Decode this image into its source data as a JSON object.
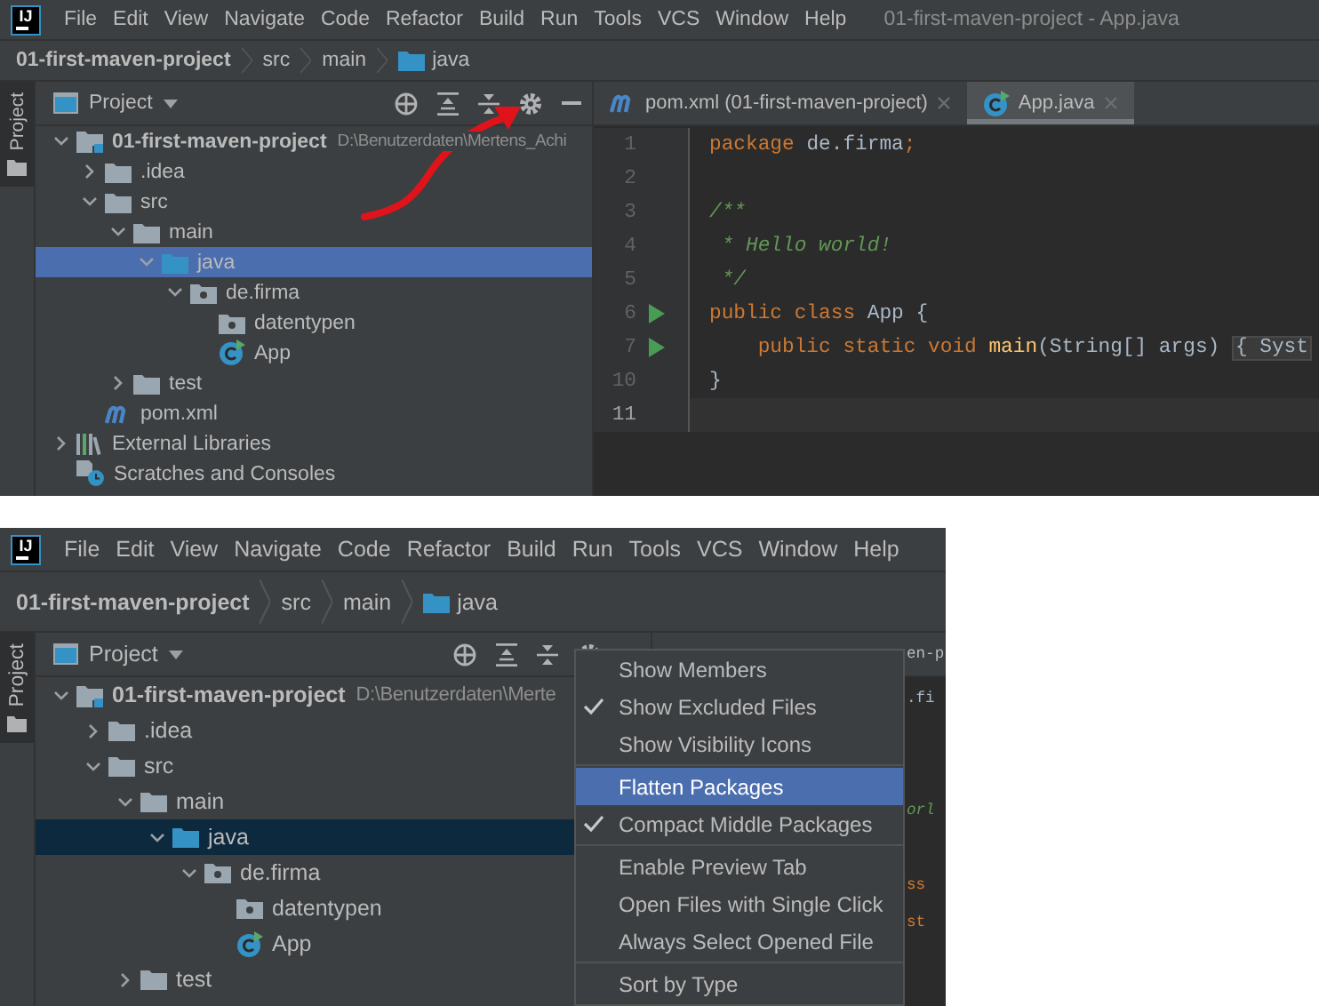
{
  "screenshots": [
    {
      "menu_bar": {
        "logo": "IJ",
        "items": [
          "File",
          "Edit",
          "View",
          "Navigate",
          "Code",
          "Refactor",
          "Build",
          "Run",
          "Tools",
          "VCS",
          "Window",
          "Help"
        ],
        "title": "01-first-maven-project - App.java"
      },
      "breadcrumb": [
        {
          "text": "01-first-maven-project",
          "kind": "project"
        },
        {
          "text": "src",
          "kind": "plain"
        },
        {
          "text": "main",
          "kind": "plain"
        },
        {
          "text": "java",
          "kind": "folder"
        }
      ],
      "tool_stripe": {
        "label": "Project",
        "selected": true
      },
      "project_panel": {
        "title": "Project",
        "focused": true,
        "tree": [
          {
            "label": "01-first-maven-project",
            "path": "D:\\Benutzerdaten\\Mertens_Achi",
            "kind": "module",
            "expanded": true,
            "selected": false,
            "children": [
              {
                "label": ".idea",
                "kind": "folder",
                "expanded": false,
                "selected": false
              },
              {
                "label": "src",
                "kind": "folder",
                "expanded": true,
                "selected": false,
                "children": [
                  {
                    "label": "main",
                    "kind": "folder",
                    "expanded": true,
                    "selected": false,
                    "children": [
                      {
                        "label": "java",
                        "kind": "source",
                        "expanded": true,
                        "selected": true,
                        "children": [
                          {
                            "label": "de.firma",
                            "kind": "package",
                            "expanded": true,
                            "selected": false,
                            "children": [
                              {
                                "label": "datentypen",
                                "kind": "package",
                                "selected": false
                              },
                              {
                                "label": "App",
                                "kind": "class",
                                "selected": false
                              }
                            ]
                          }
                        ]
                      }
                    ]
                  },
                  {
                    "label": "test",
                    "kind": "folder",
                    "expanded": false,
                    "selected": false
                  }
                ]
              },
              {
                "label": "pom.xml",
                "kind": "maven",
                "selected": false
              }
            ]
          },
          {
            "label": "External Libraries",
            "kind": "library",
            "expanded": false,
            "selected": false
          },
          {
            "label": "Scratches and Consoles",
            "kind": "scratches",
            "selected": false
          }
        ]
      },
      "editor": {
        "tabs": [
          {
            "label": "pom.xml (01-first-maven-project)",
            "kind": "maven",
            "selected": false
          },
          {
            "label": "App.java",
            "kind": "class",
            "selected": true
          }
        ],
        "lines": [
          {
            "number": "1",
            "run": false,
            "current": false,
            "tokens": [
              {
                "kind": "keyword",
                "text": "package"
              },
              {
                "kind": "plain",
                "text": " de.firma"
              },
              {
                "kind": "keyword",
                "text": ";"
              }
            ]
          },
          {
            "number": "2",
            "run": false,
            "current": false
          },
          {
            "number": "3",
            "run": false,
            "current": false,
            "tokens": [
              {
                "kind": "comment",
                "text": "/**"
              }
            ]
          },
          {
            "number": "4",
            "run": false,
            "current": false,
            "tokens": [
              {
                "kind": "comment",
                "text": " * Hello world!"
              }
            ]
          },
          {
            "number": "5",
            "run": false,
            "current": false,
            "tokens": [
              {
                "kind": "comment",
                "text": " */"
              }
            ]
          },
          {
            "number": "6",
            "run": true,
            "current": false,
            "tokens": [
              {
                "kind": "keyword",
                "text": "public class"
              },
              {
                "kind": "plain",
                "text": " App {"
              }
            ]
          },
          {
            "number": "7",
            "run": true,
            "current": false,
            "tokens": [
              {
                "kind": "keyword",
                "text": "    public static void"
              },
              {
                "kind": "method",
                "text": " main"
              },
              {
                "kind": "plain",
                "text": "(String[] args) "
              },
              {
                "kind": "folded",
                "text": "{ Syst"
              }
            ]
          },
          {
            "number": "10",
            "run": false,
            "current": false,
            "tokens": [
              {
                "kind": "plain",
                "text": "}"
              }
            ]
          },
          {
            "number": "11",
            "run": false,
            "current": true
          }
        ]
      },
      "annotation": {
        "kind": "arrow"
      }
    },
    {
      "menu_bar": {
        "logo": "IJ",
        "items": [
          "File",
          "Edit",
          "View",
          "Navigate",
          "Code",
          "Refactor",
          "Build",
          "Run",
          "Tools",
          "VCS",
          "Window",
          "Help"
        ]
      },
      "breadcrumb": [
        {
          "text": "01-first-maven-project",
          "kind": "project"
        },
        {
          "text": "src",
          "kind": "plain"
        },
        {
          "text": "main",
          "kind": "plain"
        },
        {
          "text": "java",
          "kind": "folder"
        }
      ],
      "tool_stripe": {
        "label": "Project",
        "selected": true
      },
      "project_panel": {
        "title": "Project",
        "focused": false,
        "tree": [
          {
            "label": "01-first-maven-project",
            "path": "D:\\Benutzerdaten\\Merte",
            "kind": "module",
            "expanded": true,
            "selected": false,
            "children": [
              {
                "label": ".idea",
                "kind": "folder",
                "expanded": false,
                "selected": false
              },
              {
                "label": "src",
                "kind": "folder",
                "expanded": true,
                "selected": false,
                "children": [
                  {
                    "label": "main",
                    "kind": "folder",
                    "expanded": true,
                    "selected": false,
                    "children": [
                      {
                        "label": "java",
                        "kind": "source",
                        "expanded": true,
                        "selected": true,
                        "children": [
                          {
                            "label": "de.firma",
                            "kind": "package",
                            "expanded": true,
                            "selected": false,
                            "children": [
                              {
                                "label": "datentypen",
                                "kind": "package",
                                "selected": false
                              },
                              {
                                "label": "App",
                                "kind": "class",
                                "selected": false
                              }
                            ]
                          }
                        ]
                      }
                    ]
                  },
                  {
                    "label": "test",
                    "kind": "folder",
                    "expanded": false,
                    "selected": false
                  }
                ]
              }
            ]
          }
        ]
      },
      "editor": {
        "tab_fragment": "en-p",
        "fragments": [
          {
            "kind": "plain",
            "text": ".fi"
          },
          {
            "kind": "blank"
          },
          {
            "kind": "blank"
          },
          {
            "kind": "comment",
            "text": "orl"
          },
          {
            "kind": "blank"
          },
          {
            "kind": "keyword",
            "text": "ss"
          },
          {
            "kind": "keyword",
            "text": "st"
          }
        ]
      },
      "popup_menu": {
        "groups": [
          [
            {
              "label": "Show Members",
              "checked": false,
              "selected": false
            },
            {
              "label": "Show Excluded Files",
              "checked": true,
              "selected": false
            },
            {
              "label": "Show Visibility Icons",
              "checked": false,
              "selected": false
            }
          ],
          [
            {
              "label": "Flatten Packages",
              "checked": false,
              "selected": true
            },
            {
              "label": "Compact Middle Packages",
              "checked": true,
              "selected": false
            }
          ],
          [
            {
              "label": "Enable Preview Tab",
              "checked": false,
              "selected": false
            },
            {
              "label": "Open Files with Single Click",
              "checked": false,
              "selected": false
            },
            {
              "label": "Always Select Opened File",
              "checked": false,
              "selected": false
            }
          ],
          [
            {
              "label": "Sort by Type",
              "checked": false,
              "selected": false
            }
          ]
        ]
      }
    }
  ]
}
